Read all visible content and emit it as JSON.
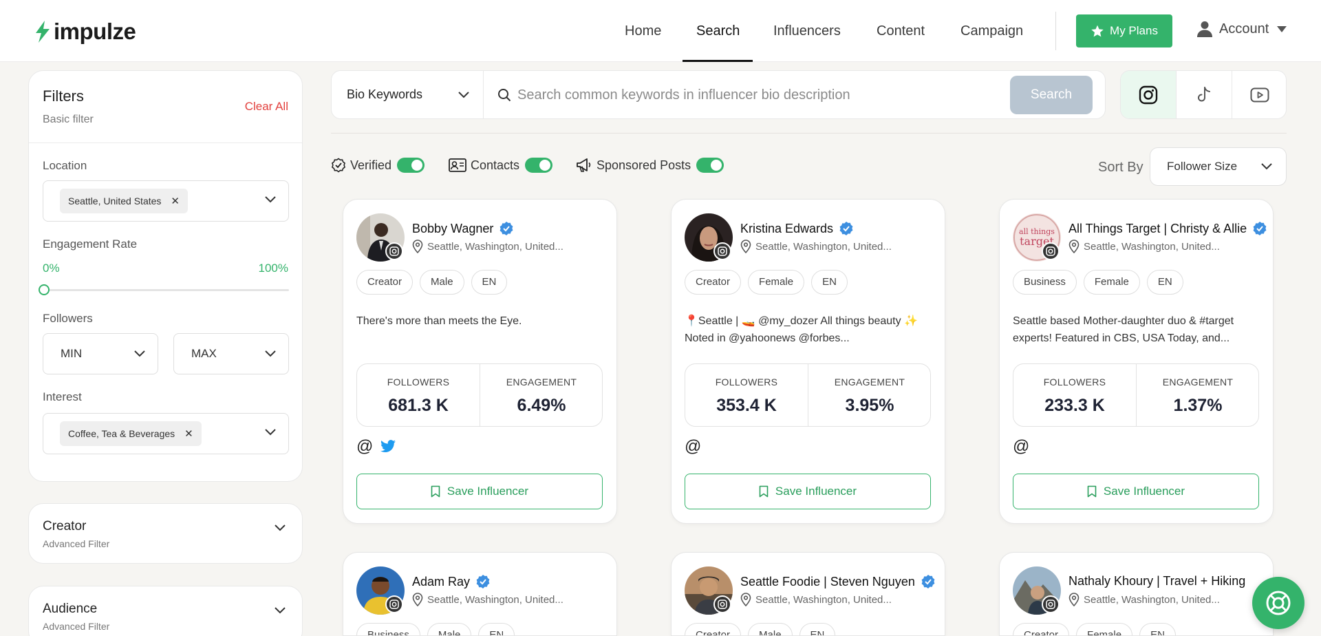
{
  "brand": {
    "name": "impulze",
    "accent": "#34b36b"
  },
  "nav": {
    "items": [
      {
        "label": "Home"
      },
      {
        "label": "Search"
      },
      {
        "label": "Influencers"
      },
      {
        "label": "Content"
      },
      {
        "label": "Campaign"
      }
    ],
    "active": "Search",
    "plans_label": "My Plans",
    "account_label": "Account"
  },
  "filters": {
    "title": "Filters",
    "subtitle": "Basic filter",
    "clear_label": "Clear All",
    "location": {
      "label": "Location",
      "chip": "Seattle, United States"
    },
    "engagement": {
      "label": "Engagement Rate",
      "min": "0%",
      "max": "100%"
    },
    "followers": {
      "label": "Followers",
      "min": "MIN",
      "max": "MAX"
    },
    "interest": {
      "label": "Interest",
      "chip": "Coffee, Tea & Beverages"
    }
  },
  "advanced": [
    {
      "title": "Creator",
      "subtitle": "Advanced Filter"
    },
    {
      "title": "Audience",
      "subtitle": "Advanced Filter"
    }
  ],
  "search": {
    "mode": "Bio Keywords",
    "placeholder": "Search common keywords in influencer bio description",
    "button": "Search",
    "platforms": [
      "instagram-icon",
      "tiktok-icon",
      "youtube-icon"
    ],
    "active_platform": "instagram-icon"
  },
  "toggles": {
    "verified": "Verified",
    "contacts": "Contacts",
    "sponsored": "Sponsored Posts"
  },
  "sort": {
    "label": "Sort By",
    "value": "Follower Size"
  },
  "card_labels": {
    "followers": "FOLLOWERS",
    "engagement": "ENGAGEMENT",
    "save": "Save Influencer"
  },
  "cards": [
    {
      "name": "Bobby Wagner",
      "location": "Seattle, Washington, United...",
      "tags": [
        "Creator",
        "Male",
        "EN"
      ],
      "bio": "There's more than meets the Eye.",
      "followers": "681.3 K",
      "engagement": "6.49%"
    },
    {
      "name": "Kristina Edwards",
      "location": "Seattle, Washington, United...",
      "tags": [
        "Creator",
        "Female",
        "EN"
      ],
      "bio": "📍Seattle | 🚤 @my_dozer All things beauty ✨ Noted in @yahoonews @forbes...",
      "followers": "353.4 K",
      "engagement": "3.95%"
    },
    {
      "name": "All Things Target | Christy & Allie",
      "location": "Seattle, Washington, United...",
      "tags": [
        "Business",
        "Female",
        "EN"
      ],
      "bio": "Seattle based Mother-daughter duo & #target experts! Featured in CBS, USA Today, and...",
      "followers": "233.3 K",
      "engagement": "1.37%"
    },
    {
      "name": "Adam Ray",
      "location": "Seattle, Washington, United...",
      "tags": [
        "Business",
        "Male",
        "EN"
      ]
    },
    {
      "name": "Seattle Foodie | Steven Nguyen",
      "location": "Seattle, Washington, United...",
      "tags": [
        "Creator",
        "Male",
        "EN"
      ]
    },
    {
      "name": "Nathaly Khoury | Travel + Hiking",
      "location": "Seattle, Washington, United...",
      "tags": [
        "Creator",
        "Female",
        "EN"
      ]
    }
  ]
}
